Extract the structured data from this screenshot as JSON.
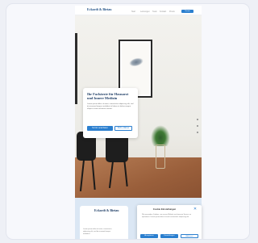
{
  "logo": "Eckardt & Bietau",
  "nav": {
    "links": [
      "Start",
      "Leistungen",
      "Team",
      "Kontakt",
      "Praxis"
    ],
    "cta": "Termin"
  },
  "hero": {
    "title": "Ihr Fachärzte für Hausarzt und Innere Medizin",
    "text": "Lorem ipsum dolor sit amet, consectetur adipiscing elit, sed do eiusmod tempor incididunt ut labore et dolore magna aliqua ut enim ad minim veniam.",
    "primary": "Termin vereinbaren",
    "secondary": "Mehr erfahren"
  },
  "section": {
    "title": "Eckardt & Bietau",
    "text": "Lorem ipsum dolor sit amet, consectetur adipiscing elit, sed do eiusmod tempor incididunt."
  },
  "cookie": {
    "title": "Cookie Einstellungen",
    "close": "✕",
    "text": "Wir verwenden Cookies, um unsere Website und unseren Service zu optimieren. Lorem ipsum dolor sit amet consectetur adipiscing elit.",
    "accept": "Akzeptieren",
    "settings": "Einstellungen",
    "deny": "Ablehnen"
  },
  "colors": {
    "accent": "#2b7fcf",
    "brand": "#1f4f86",
    "floor": "#9a5f3b"
  }
}
